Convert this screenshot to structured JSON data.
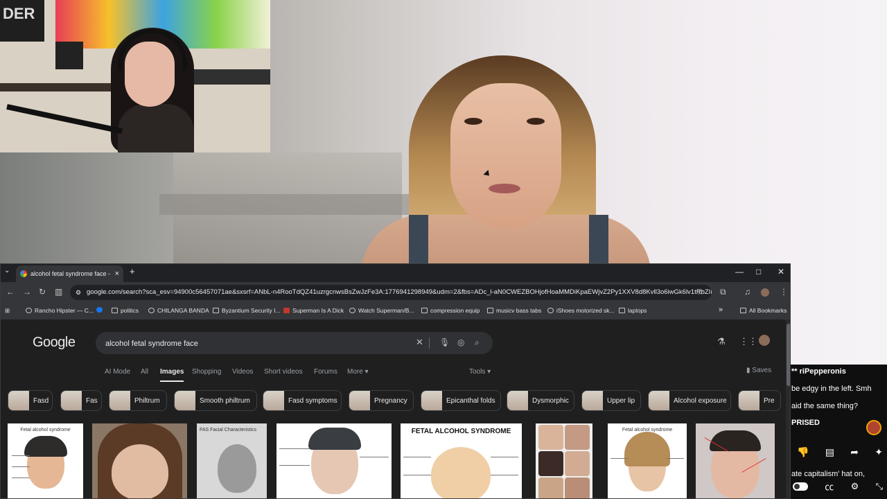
{
  "webcam": {
    "poster_text": "DER"
  },
  "chat": {
    "lines": [
      "** riPepperonis",
      "be edgy in the left. Smh",
      "aid the same thing?",
      "PRISED",
      "ate capitalism' hat on,"
    ],
    "actions": [
      "dislike-icon",
      "comment-icon",
      "share-icon",
      "sparkle-icon"
    ],
    "controls": [
      "toggle",
      "cc-icon",
      "gear-icon",
      "collapse-icon"
    ]
  },
  "browser": {
    "tab_title": "alcohol fetal syndrome face - G",
    "tab_close": "×",
    "new_tab": "+",
    "window_controls": [
      "—",
      "□",
      "✕"
    ],
    "url": "google.com/search?sca_esv=94900c56457071ae&sxsrf=ANbL-n4RooTdQZ41uzrgcnwsBsZwJzFe3A:1776941298949&udm=2&fbs=ADc_l-aN0CWEZBOHjofHoaMMDiKpaEWjvZ2Py1XXV8d8Kvll3o6iwGk6lv1tRbZIB...",
    "bookmarks": [
      "Rancho Hipster — C...",
      "politics",
      "CHILANGA BANDA",
      "Byzantium Security I...",
      "Superman Is A Dick",
      "Watch Superman/B...",
      "compression equip",
      "musicv bass tabs",
      "iShoes motorized sk...",
      "laptops"
    ],
    "bookmarks_overflow": "»",
    "all_bookmarks": "All Bookmarks"
  },
  "google": {
    "logo": "Google",
    "query": "alcohol fetal syndrome face",
    "tabs": [
      "AI Mode",
      "All",
      "Images",
      "Shopping",
      "Videos",
      "Short videos",
      "Forums",
      "More ▾"
    ],
    "active_tab": "Images",
    "tools": "Tools ▾",
    "saves": "Saves",
    "chips": [
      "Fasd",
      "Fas",
      "Philtrum",
      "Smooth philtrum",
      "Fasd symptoms",
      "Pregnancy",
      "Epicanthal folds",
      "Dysmorphic",
      "Upper lip",
      "Alcohol exposure",
      "Pre"
    ],
    "results": [
      {
        "caption": "Fetal alcohol syndrome"
      },
      {
        "caption": ""
      },
      {
        "caption": "FAS Facial Characteristics"
      },
      {
        "caption": ""
      },
      {
        "caption": "FETAL ALCOHOL SYNDROME"
      },
      {
        "caption": ""
      },
      {
        "caption": "Fetal alcohol syndrome"
      },
      {
        "caption": ""
      }
    ]
  }
}
